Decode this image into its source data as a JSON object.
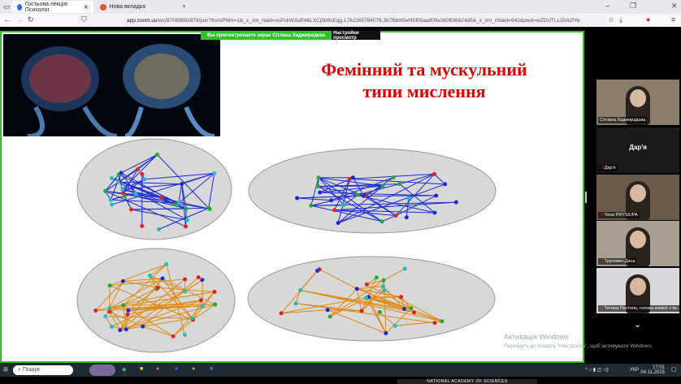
{
  "browser": {
    "tabs": [
      {
        "label": "Гостьова лекція: Психолог",
        "active": true,
        "color": "#2d6cf6"
      },
      {
        "label": "Нова вкладка",
        "active": false,
        "color": "#e8532f"
      }
    ],
    "url_host": "app.zoom.us",
    "url_rest": "/wc/87089882879/join?fromPWA=1&_x_zm_rtaid=xsPckW3uR46LXCj5b9sEqg.1762265784076.3b7fbbb5ef45f05aa909e3b0636824d5&_x_zm_rhtaid=942&pwd=wZDUTLL00A2fYe"
  },
  "zoom": {
    "share_banner": "Вы просматриваете экран  Сітлана Хаджирадєва",
    "view_settings": "Настройки просмотр",
    "participants": [
      {
        "name": "Сітлана Хаджирадєва",
        "video": true,
        "bg": "#8a7d6a",
        "muted": false
      },
      {
        "name": "Дар'я",
        "video": false,
        "bg": "#1a1a1a",
        "muted": true
      },
      {
        "name": "Yana PRYSIUPA",
        "video": true,
        "bg": "#6b5a48",
        "muted": true
      },
      {
        "name": "Трусевич Дана",
        "video": true,
        "bg": "#a89e92",
        "muted": true
      },
      {
        "name": "Тетяна Постоян, голова комісії з як...",
        "video": true,
        "bg": "#d8d8dc",
        "muted": true
      }
    ]
  },
  "slide": {
    "title_line1": "Фемінний та мускульний",
    "title_line2": "типи мислення",
    "credit": "NATIONAL ACADEMY OF SCIENCES",
    "network_colors": {
      "male": "#1a2bd6",
      "female": "#e08a10"
    }
  },
  "windows": {
    "activation_title": "Активація Windows",
    "activation_text": "Перейдіть до розділу \"Настройки\", щоб активувати Windows.",
    "search_placeholder": "Пошук",
    "lang": "УКР",
    "time": "17:01",
    "date": "04.11.2025"
  }
}
